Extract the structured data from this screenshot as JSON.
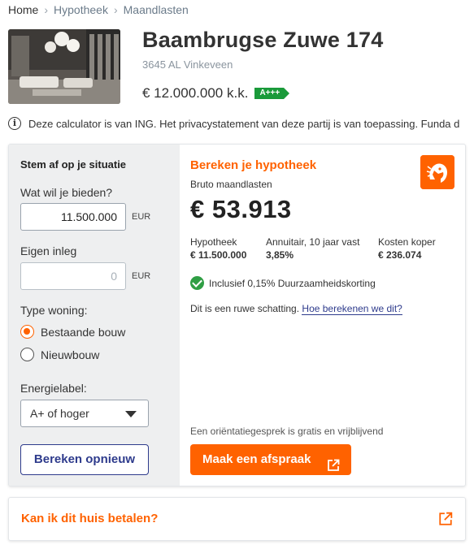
{
  "breadcrumb": {
    "home": "Home",
    "mortgage": "Hypotheek",
    "monthly": "Maandlasten"
  },
  "listing": {
    "title": "Baambrugse Zuwe 174",
    "address": "3645 AL Vinkeveen",
    "price": "€ 12.000.000 k.k.",
    "energy_label": "A+++",
    "photo_icon": "interior-photo"
  },
  "notice": {
    "icon": "info-icon",
    "text": "Deze calculator is van ING. Het privacystatement van deze partij is van toepassing. Funda d"
  },
  "form": {
    "heading": "Stem af op je situatie",
    "bid_label": "Wat wil je bieden?",
    "bid_value": "11.500.000",
    "bid_unit": "EUR",
    "own_funds_label": "Eigen inleg",
    "own_funds_placeholder": "0",
    "own_funds_unit": "EUR",
    "home_type_label": "Type woning:",
    "home_type_options": [
      "Bestaande bouw",
      "Nieuwbouw"
    ],
    "energy_label_label": "Energielabel:",
    "energy_label_value": "A+ of hoger",
    "recalc_button": "Bereken opnieuw"
  },
  "result": {
    "title": "Bereken je hypotheek",
    "subtitle": "Bruto maandlasten",
    "amount": "€ 53.913",
    "stats": [
      {
        "label": "Hypotheek",
        "value": "€ 11.500.000"
      },
      {
        "label": "Annuitair, 10 jaar vast",
        "value": "3,85%"
      },
      {
        "label": "Kosten koper",
        "value": "€ 236.074"
      }
    ],
    "discount_text": "Inclusief 0,15% Duurzaamheidskorting",
    "estimate_text": "Dit is een ruwe schatting.",
    "estimate_link": "Hoe berekenen we dit?",
    "orientation_text": "Een oriëntatiegesprek is gratis en vrijblijvend",
    "appointment_button": "Maak een afspraak",
    "logo": "ing-lion-logo"
  },
  "afford": {
    "title": "Kan ik dit huis betalen?"
  },
  "colors": {
    "accent": "#ff6200",
    "navy": "#2e3b8c",
    "green": "#1a9a3a"
  }
}
